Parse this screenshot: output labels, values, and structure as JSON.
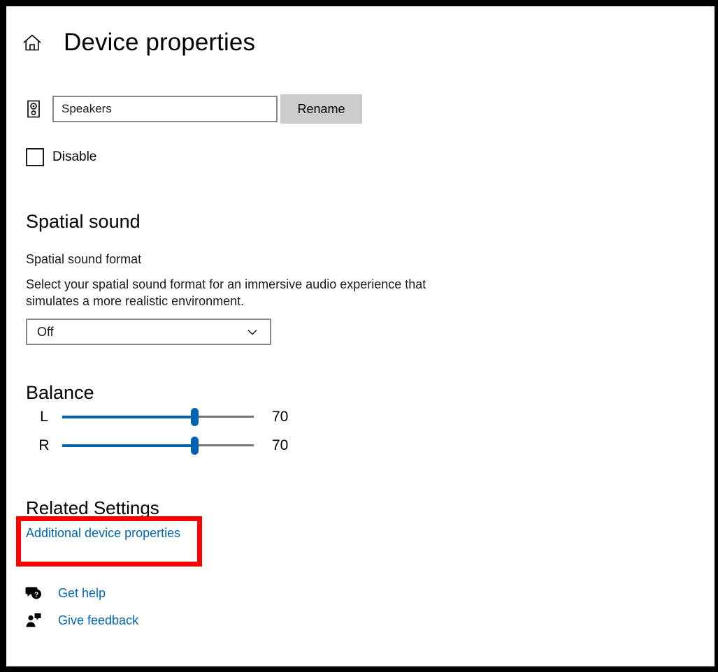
{
  "window": {
    "frame_color": "#000000",
    "background": "#ffffff"
  },
  "header": {
    "home_icon": "home-icon",
    "title": "Device properties"
  },
  "device": {
    "icon": "speaker-icon",
    "name_value": "Speakers",
    "name_placeholder": "Speakers",
    "rename_label": "Rename"
  },
  "disable": {
    "label": "Disable",
    "checked": false
  },
  "spatial_sound": {
    "heading": "Spatial sound",
    "format_label": "Spatial sound format",
    "description": "Select your spatial sound format for an immersive audio experience that simulates a more realistic environment.",
    "selected_option": "Off",
    "options": [
      "Off"
    ],
    "chevron_icon": "chevron-down-icon"
  },
  "balance": {
    "heading": "Balance",
    "channels": [
      {
        "label": "L",
        "value": "70",
        "percent": 69
      },
      {
        "label": "R",
        "value": "70",
        "percent": 69
      }
    ]
  },
  "related_settings": {
    "heading": "Related Settings",
    "link_label": "Additional device properties",
    "highlight_color": "#ff0000"
  },
  "help": {
    "items": [
      {
        "icon": "question-bubble-icon",
        "label": "Get help"
      },
      {
        "icon": "feedback-person-icon",
        "label": "Give feedback"
      }
    ]
  },
  "colors": {
    "link": "#0066b4",
    "accent": "#0063b1",
    "button_gray": "#cccccc",
    "border_gray": "#8a8a8a",
    "rail_gray": "#767676"
  }
}
